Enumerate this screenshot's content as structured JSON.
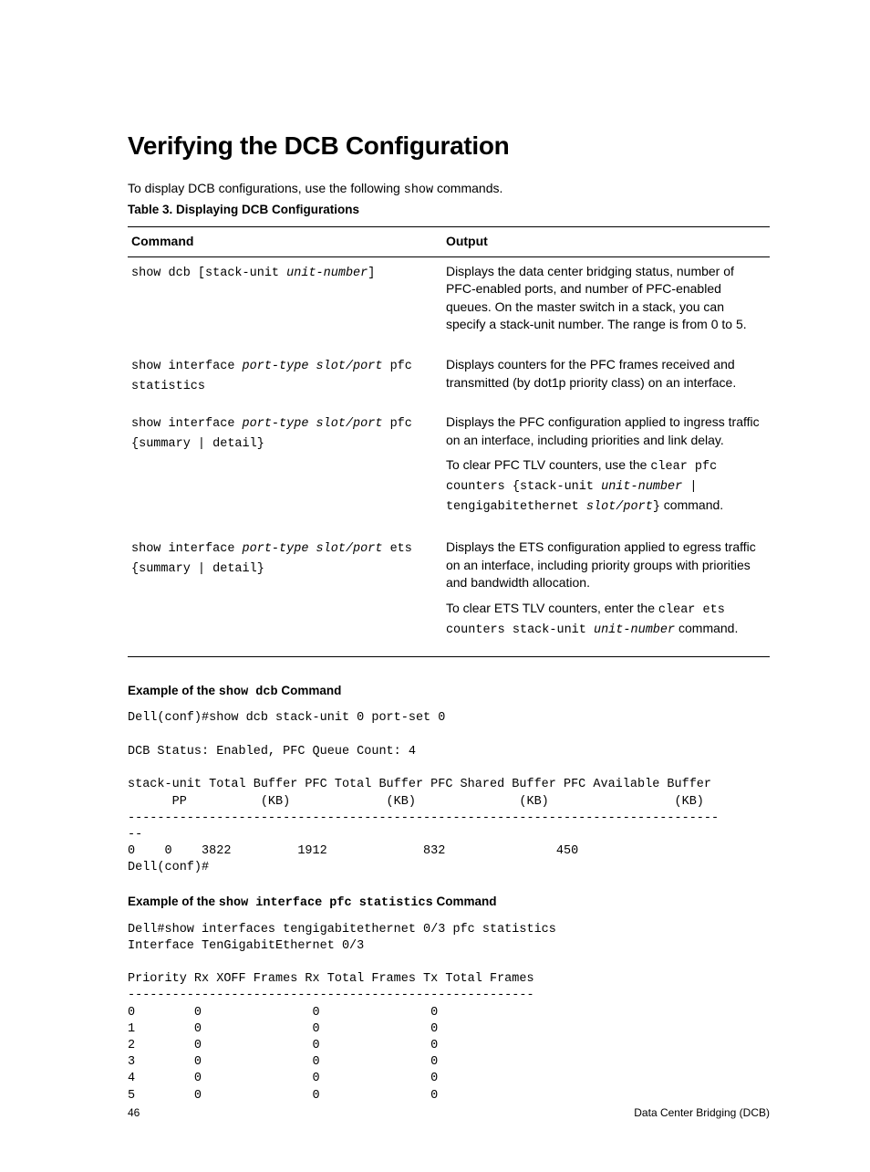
{
  "heading": "Verifying the DCB Configuration",
  "intro_pre": "To display DCB configurations, use the following ",
  "intro_code": "show",
  "intro_post": " commands.",
  "table_caption": "Table 3. Displaying DCB Configurations",
  "table": {
    "head_cmd": "Command",
    "head_out": "Output",
    "rows": [
      {
        "cmd_parts": [
          {
            "t": "show dcb [stack-unit ",
            "i": false
          },
          {
            "t": "unit-number",
            "i": true
          },
          {
            "t": "]",
            "i": false
          }
        ],
        "out_blocks": [
          {
            "text_pre": "Displays the data center bridging status, number of PFC-enabled ports, and number of PFC-enabled queues. On the master switch in a stack, you can specify a stack-unit number. The range is from 0 to 5.",
            "code_parts": []
          }
        ]
      },
      {
        "cmd_parts": [
          {
            "t": "show interface ",
            "i": false
          },
          {
            "t": "port-type slot/port",
            "i": true
          },
          {
            "t": " pfc statistics",
            "i": false
          }
        ],
        "out_blocks": [
          {
            "text_pre": "Displays counters for the PFC frames received and transmitted (by dot1p priority class) on an interface.",
            "code_parts": []
          }
        ]
      },
      {
        "cmd_parts": [
          {
            "t": "show interface ",
            "i": false
          },
          {
            "t": "port-type slot/port",
            "i": true
          },
          {
            "t": " pfc {summary | detail}",
            "i": false
          }
        ],
        "out_blocks": [
          {
            "text_pre": "Displays the PFC configuration applied to ingress traffic on an interface, including priorities and link delay.",
            "code_parts": []
          },
          {
            "text_pre": "To clear PFC TLV counters, use the ",
            "code_parts": [
              {
                "t": "clear pfc counters {stack-unit ",
                "i": false
              },
              {
                "t": "unit-number",
                "i": true
              },
              {
                "t": " | tengigabitethernet ",
                "i": false
              },
              {
                "t": "slot/port",
                "i": true
              },
              {
                "t": "}",
                "i": false
              }
            ],
            "text_post": " command."
          }
        ]
      },
      {
        "cmd_parts": [
          {
            "t": "show interface ",
            "i": false
          },
          {
            "t": "port-type slot/port",
            "i": true
          },
          {
            "t": " ets {summary | detail}",
            "i": false
          }
        ],
        "out_blocks": [
          {
            "text_pre": "Displays the ETS configuration applied to egress traffic on an interface, including priority groups with priorities and bandwidth allocation.",
            "code_parts": []
          },
          {
            "text_pre": "To clear ETS TLV counters, enter the ",
            "code_parts": [
              {
                "t": "clear ets counters stack-unit ",
                "i": false
              },
              {
                "t": "unit-number",
                "i": true
              }
            ],
            "text_post": " command."
          }
        ]
      }
    ]
  },
  "example1_heading_pre": "Example of the ",
  "example1_heading_code": "show dcb",
  "example1_heading_post": " Command",
  "example1_cli": "Dell(conf)#show dcb stack-unit 0 port-set 0\n\nDCB Status: Enabled, PFC Queue Count: 4\n\nstack-unit Total Buffer PFC Total Buffer PFC Shared Buffer PFC Available Buffer\n      PP          (KB)             (KB)              (KB)                 (KB)\n--------------------------------------------------------------------------------\n--\n0    0    3822         1912             832               450\nDell(conf)#",
  "example2_heading_pre": "Example of the ",
  "example2_heading_code": "show interface pfc statistics",
  "example2_heading_post": " Command",
  "example2_cli": "Dell#show interfaces tengigabitethernet 0/3 pfc statistics\nInterface TenGigabitEthernet 0/3\n\nPriority Rx XOFF Frames Rx Total Frames Tx Total Frames\n-------------------------------------------------------\n0        0               0               0\n1        0               0               0\n2        0               0               0\n3        0               0               0\n4        0               0               0\n5        0               0               0",
  "footer_left": "46",
  "footer_right": "Data Center Bridging (DCB)"
}
